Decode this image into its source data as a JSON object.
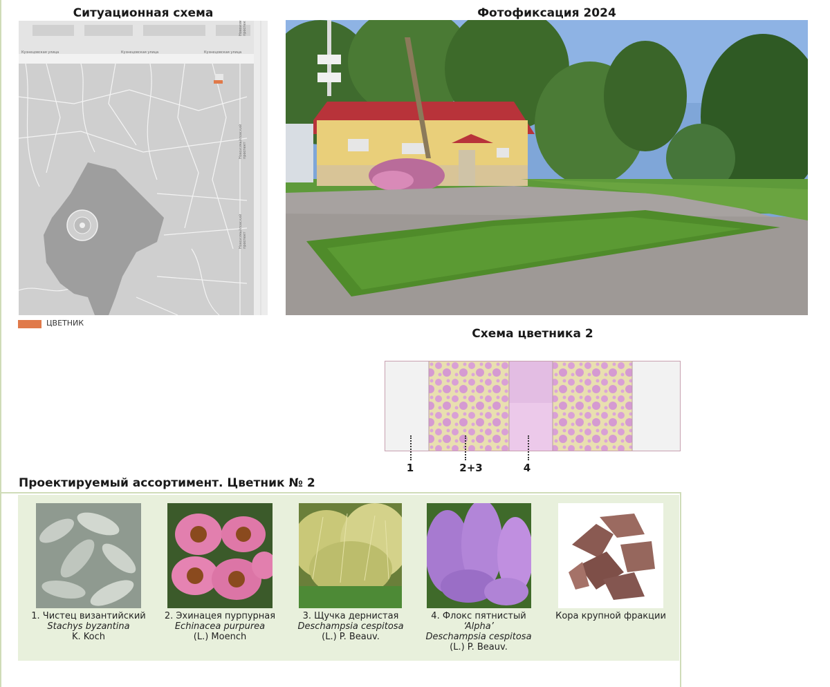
{
  "headings": {
    "situation": "Ситуационная схема",
    "photo": "Фотофиксация 2024",
    "scheme": "Схема цветника 2",
    "assortment": "Проектируемый ассортимент. Цветник № 2"
  },
  "map": {
    "legend_label": "ЦВЕТНИК",
    "legend_color": "#e07a4a",
    "street_labels": [
      "Кузнецовская улица",
      "Кузнецовская улица",
      "Кузнецовская улица",
      "Новоизмайловский проспект",
      "Новоизмайловский проспект",
      "Новоизмайловский проспект"
    ]
  },
  "scheme": {
    "markers": [
      "1",
      "2+3",
      "4"
    ]
  },
  "plants": [
    {
      "name": "1. Чистец византийский",
      "latin": "Stachys byzantina",
      "author": "K. Koch",
      "icon": "lambs-ear-photo"
    },
    {
      "name": "2. Эхинацея пурпурная",
      "latin": "Echinacea purpurea",
      "author": "(L.) Moench",
      "icon": "echinacea-photo"
    },
    {
      "name": "3. Щучка дернистая",
      "latin": "Deschampsia cespitosa",
      "author": "(L.) P. Beauv.",
      "icon": "grass-photo"
    },
    {
      "name": "4. Флокс пятнистый",
      "cultivar": "‘Alpha’",
      "latin": "Deschampsia cespitosa",
      "author": "(L.) P. Beauv.",
      "icon": "phlox-photo"
    },
    {
      "name": "Кора крупной фракции",
      "icon": "bark-photo"
    }
  ]
}
